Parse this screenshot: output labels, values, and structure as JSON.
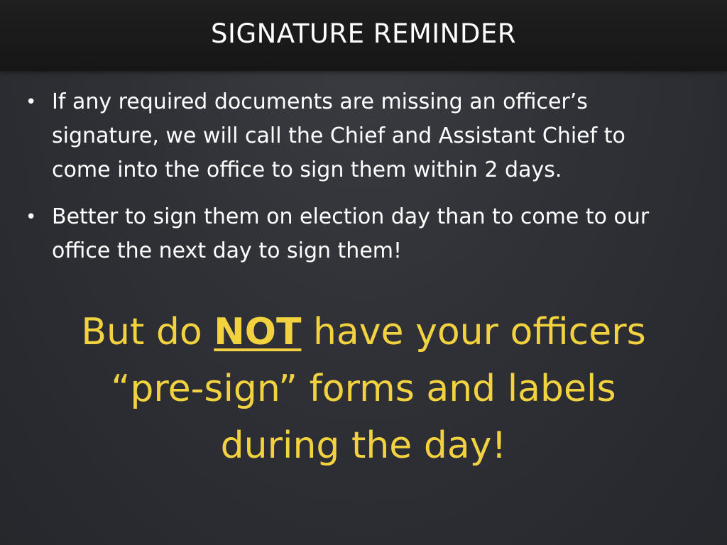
{
  "slide": {
    "title": "SIGNATURE REMINDER",
    "bullets": [
      {
        "marker": "•",
        "text": "If any required documents are missing an officer’s signature, we will call the Chief and Assistant Chief to come into the office to sign them within 2 days."
      },
      {
        "marker": "•",
        "text": "Better to sign them on election day than to come to our office the next day to sign them!"
      }
    ],
    "callout": {
      "before": "But do ",
      "emphasis": "NOT",
      "after_line1": " have your officers",
      "line2": "“pre-sign” forms and labels",
      "line3": "during the day!"
    }
  },
  "colors": {
    "title_bar": "#1a1a1a",
    "background": "#2f3137",
    "title_text": "#ffffff",
    "body_text": "#ffffff",
    "callout_text": "#f2d33f"
  }
}
